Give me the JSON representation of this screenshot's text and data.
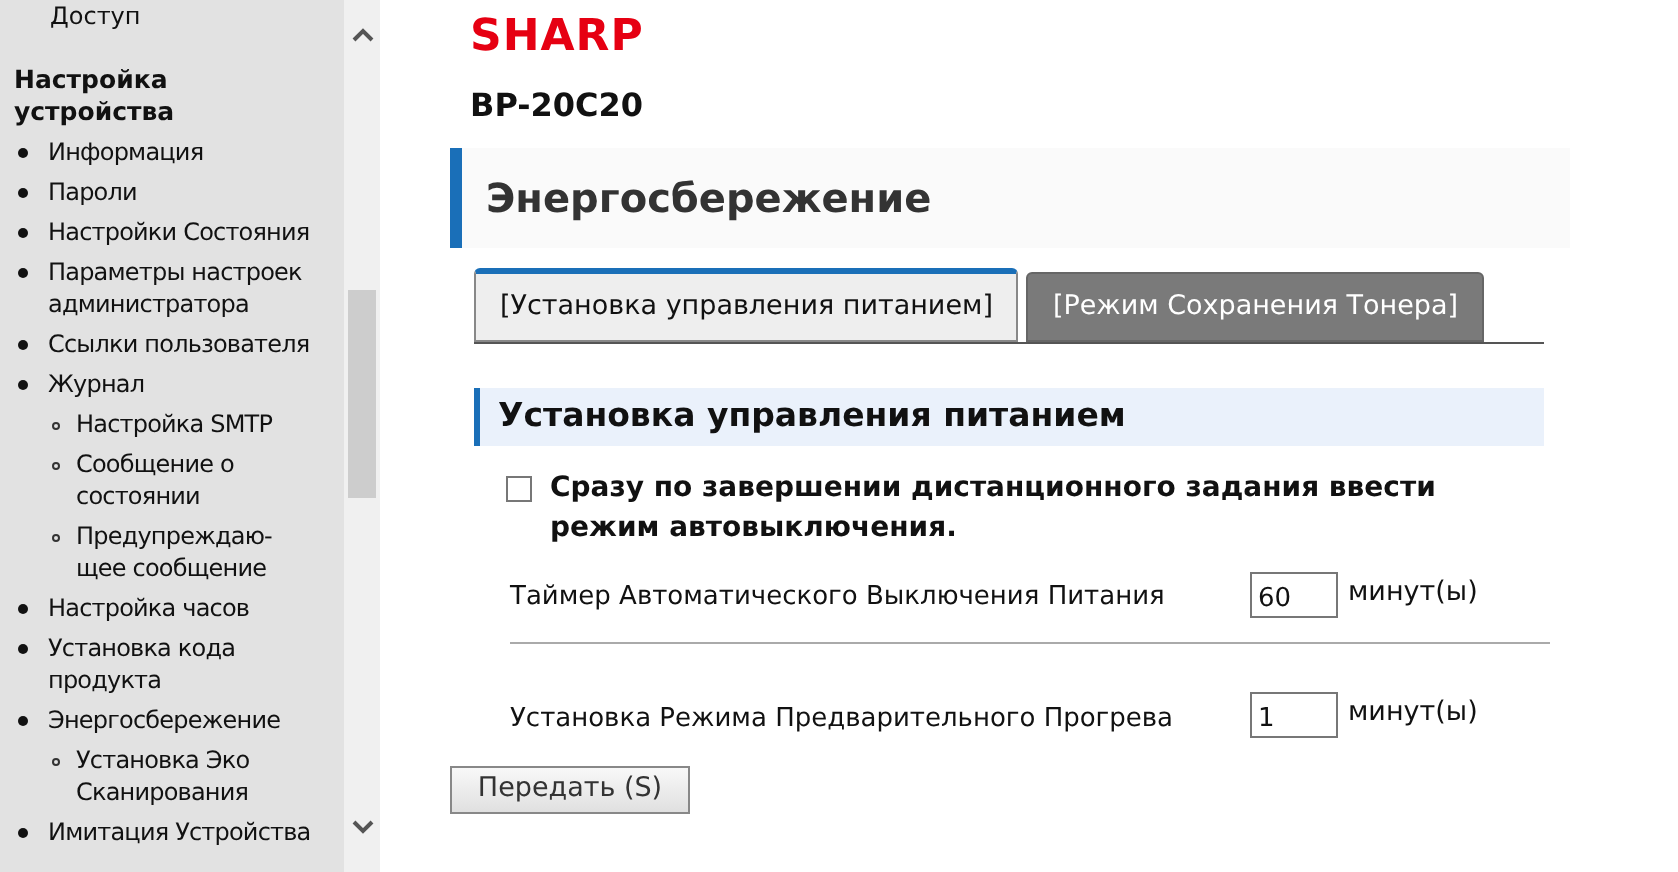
{
  "sidebar": {
    "continued_item": "Доступ",
    "section_title": "Настройка устройства",
    "items": [
      {
        "label": "Информация"
      },
      {
        "label": "Пароли"
      },
      {
        "label": "Настройки Состояния"
      },
      {
        "label": "Параметры настроек администратора"
      },
      {
        "label": "Ссылки пользователя"
      },
      {
        "label": "Журнал",
        "children": [
          {
            "label": "Настройка SMTP"
          },
          {
            "label": "Сообщение о состоянии"
          },
          {
            "label": "Предупреждаю-щее сообщение"
          }
        ]
      },
      {
        "label": "Настройка часов"
      },
      {
        "label": "Установка кода продукта"
      },
      {
        "label": "Энергосбережение",
        "children": [
          {
            "label": "Установка Эко Сканирования"
          }
        ]
      },
      {
        "label": "Имитация Устройства"
      }
    ]
  },
  "logo": "SHARP",
  "model": "BP-20C20",
  "page_title": "Энергосбережение",
  "tabs": [
    {
      "label": "[Установка управления питанием]",
      "selected": true
    },
    {
      "label": "[Режим Сохранения Тонера]",
      "selected": false
    }
  ],
  "section": {
    "title": "Установка управления питанием",
    "checkbox": {
      "label": "Сразу по завершении дистанционного задания ввести режим автовыключения.",
      "checked": false
    },
    "fields": [
      {
        "label": "Таймер Автоматического Выключения Питания",
        "value": "60",
        "unit": "минут(ы)"
      },
      {
        "label": "Установка Режима Предварительного Прогрева",
        "value": "1",
        "unit": "минут(ы)"
      }
    ]
  },
  "submit_button": "Передать (S)"
}
